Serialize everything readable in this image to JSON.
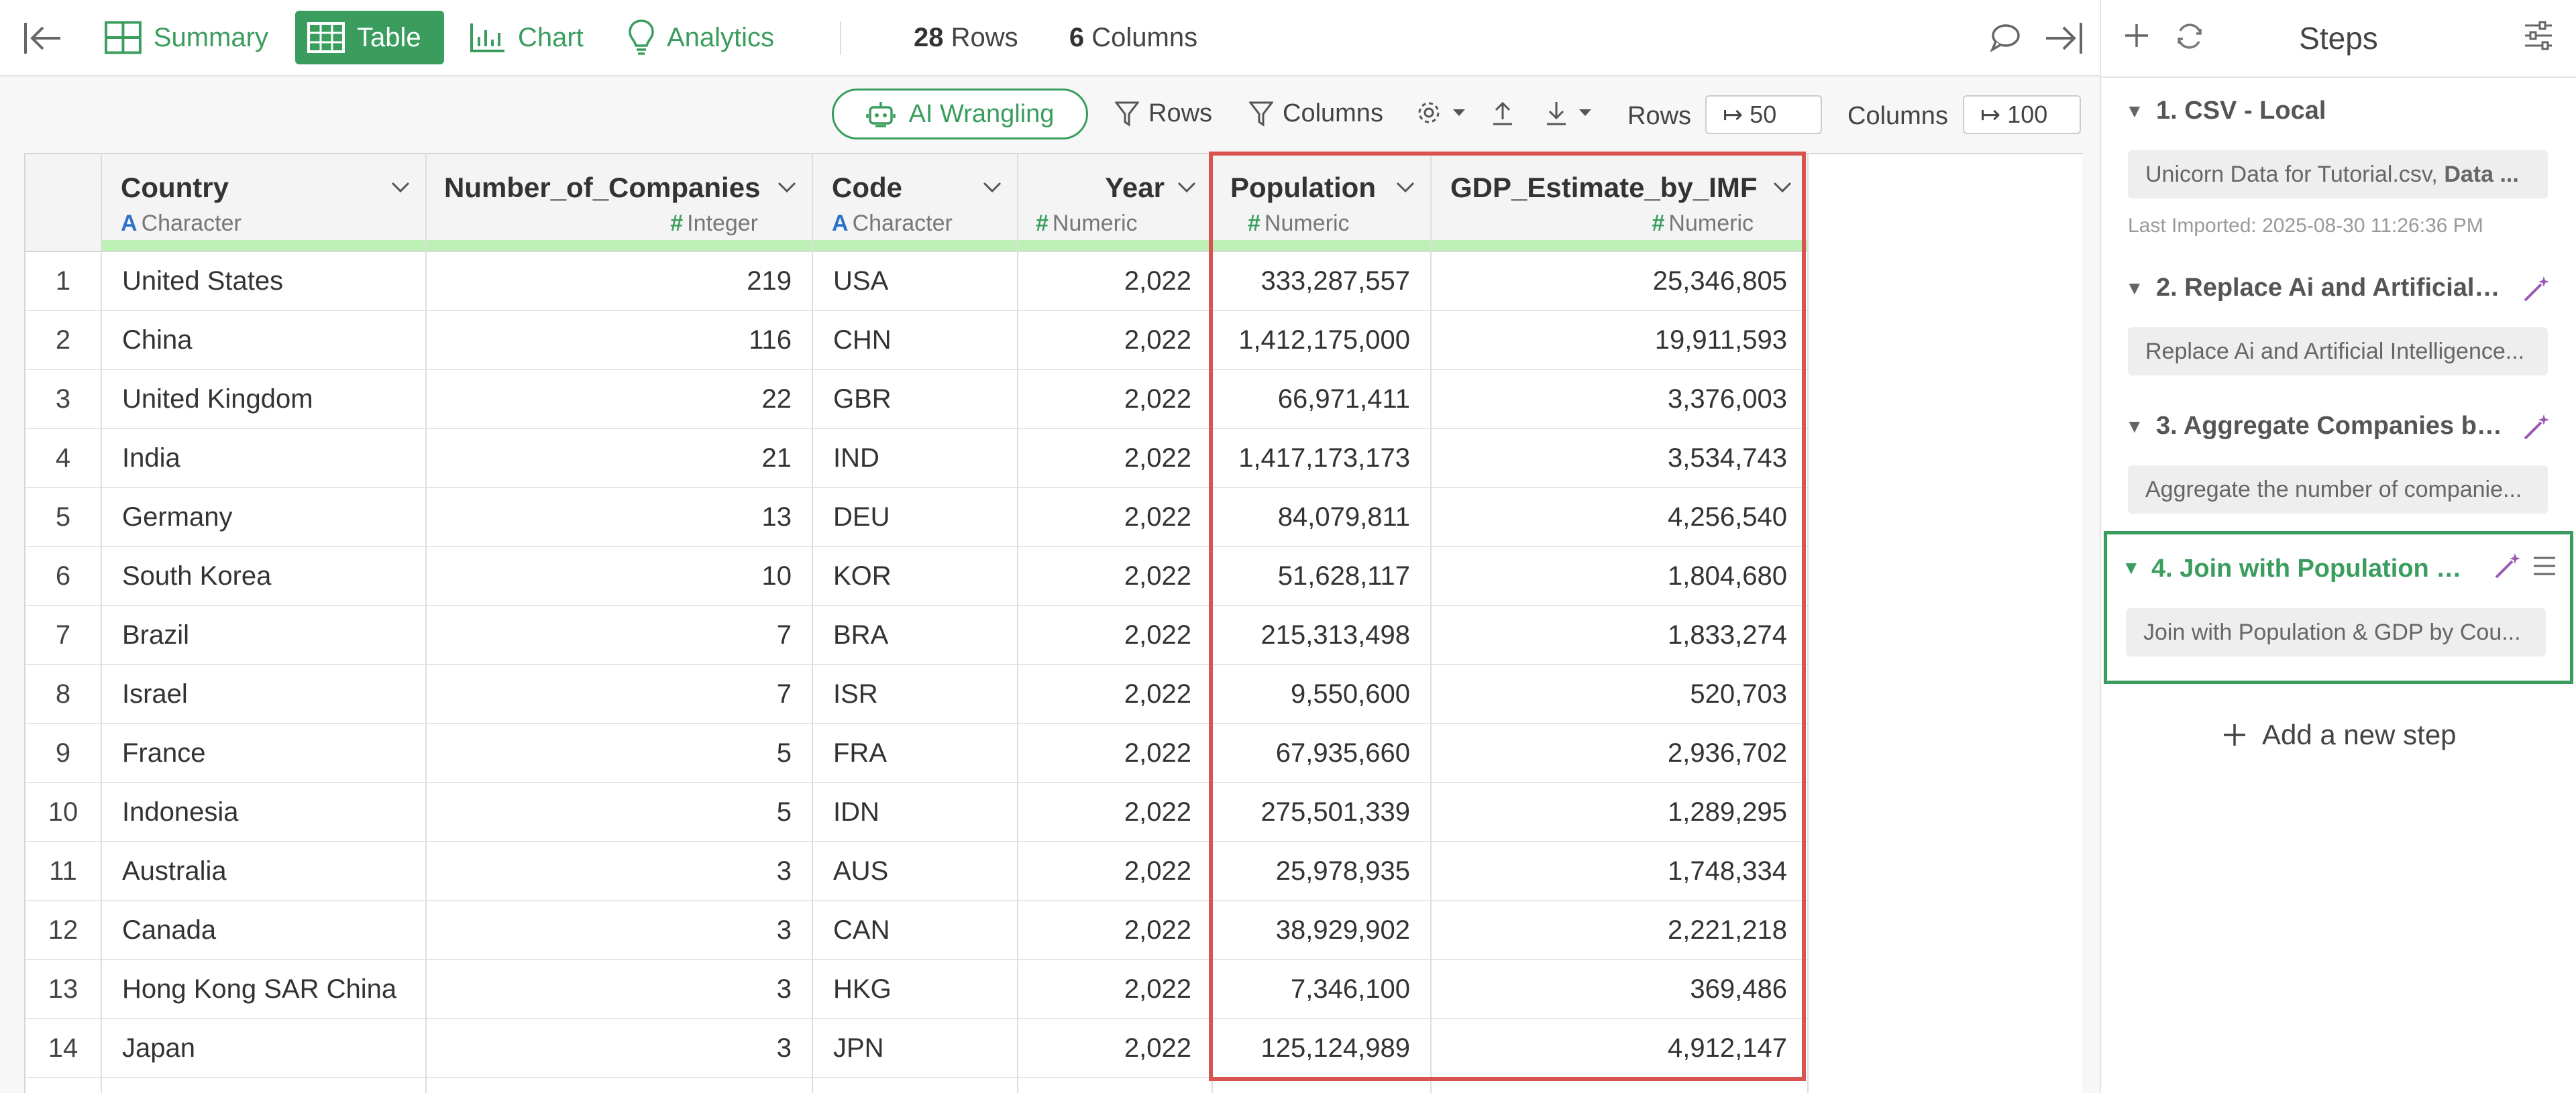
{
  "topbar": {
    "tabs": [
      {
        "label": "Summary",
        "icon": "summary-icon"
      },
      {
        "label": "Table",
        "icon": "table-icon",
        "active": true
      },
      {
        "label": "Chart",
        "icon": "chart-icon"
      },
      {
        "label": "Analytics",
        "icon": "lightbulb-icon"
      }
    ],
    "rows_count": "28",
    "rows_label": "Rows",
    "cols_count": "6",
    "cols_label": "Columns"
  },
  "toolbar": {
    "ai_label": "AI Wrangling",
    "rows_filter": "Rows",
    "cols_filter": "Columns",
    "rows_label": "Rows",
    "rows_value": "↦ 50",
    "cols_label": "Columns",
    "cols_value": "↦ 100"
  },
  "table": {
    "columns": [
      {
        "name": "Country",
        "type": "Character",
        "type_icon": "A"
      },
      {
        "name": "Number_of_Companies",
        "type": "Integer",
        "type_icon": "#"
      },
      {
        "name": "Code",
        "type": "Character",
        "type_icon": "A"
      },
      {
        "name": "Year",
        "type": "Numeric",
        "type_icon": "#"
      },
      {
        "name": "Population",
        "type": "Numeric",
        "type_icon": "#"
      },
      {
        "name": "GDP_Estimate_by_IMF",
        "type": "Numeric",
        "type_icon": "#"
      }
    ],
    "rows": [
      [
        "1",
        "United States",
        "219",
        "USA",
        "2,022",
        "333,287,557",
        "25,346,805"
      ],
      [
        "2",
        "China",
        "116",
        "CHN",
        "2,022",
        "1,412,175,000",
        "19,911,593"
      ],
      [
        "3",
        "United Kingdom",
        "22",
        "GBR",
        "2,022",
        "66,971,411",
        "3,376,003"
      ],
      [
        "4",
        "India",
        "21",
        "IND",
        "2,022",
        "1,417,173,173",
        "3,534,743"
      ],
      [
        "5",
        "Germany",
        "13",
        "DEU",
        "2,022",
        "84,079,811",
        "4,256,540"
      ],
      [
        "6",
        "South Korea",
        "10",
        "KOR",
        "2,022",
        "51,628,117",
        "1,804,680"
      ],
      [
        "7",
        "Brazil",
        "7",
        "BRA",
        "2,022",
        "215,313,498",
        "1,833,274"
      ],
      [
        "8",
        "Israel",
        "7",
        "ISR",
        "2,022",
        "9,550,600",
        "520,703"
      ],
      [
        "9",
        "France",
        "5",
        "FRA",
        "2,022",
        "67,935,660",
        "2,936,702"
      ],
      [
        "10",
        "Indonesia",
        "5",
        "IDN",
        "2,022",
        "275,501,339",
        "1,289,295"
      ],
      [
        "11",
        "Australia",
        "3",
        "AUS",
        "2,022",
        "25,978,935",
        "1,748,334"
      ],
      [
        "12",
        "Canada",
        "3",
        "CAN",
        "2,022",
        "38,929,902",
        "2,221,218"
      ],
      [
        "13",
        "Hong Kong SAR China",
        "3",
        "HKG",
        "2,022",
        "7,346,100",
        "369,486"
      ],
      [
        "14",
        "Japan",
        "3",
        "JPN",
        "2,022",
        "125,124,989",
        "4,912,147"
      ]
    ]
  },
  "steps": {
    "title": "Steps",
    "items": [
      {
        "label": "1. CSV - Local",
        "desc_prefix": "Unicorn Data for Tutorial.csv, ",
        "desc_bold": "Data ...",
        "meta": "Last Imported: 2025-08-30 11:26:36 PM"
      },
      {
        "label": "2. Replace Ai and Artificial I...",
        "desc": "Replace Ai and Artificial Intelligence..."
      },
      {
        "label": "3. Aggregate Companies by...",
        "desc": "Aggregate the number of companie..."
      },
      {
        "label": "4. Join with Population & ...",
        "desc": "Join with Population & GDP by Cou..."
      }
    ],
    "add_label": "Add a new step"
  },
  "colors": {
    "accent": "#3a9d5d",
    "highlight": "#d9534f",
    "header_bar": "#bdf0b4"
  }
}
